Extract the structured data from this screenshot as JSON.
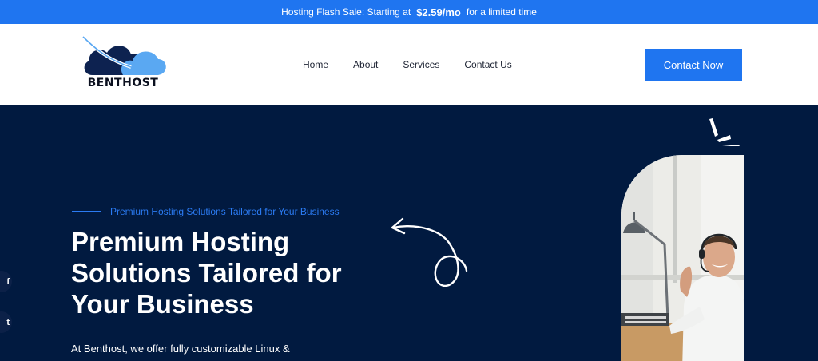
{
  "topbar": {
    "text_before": "Hosting Flash Sale: Starting at",
    "price": "$2.59/mo",
    "text_after": "for a limited time"
  },
  "header": {
    "logo_text": "BENTHOST",
    "nav": [
      {
        "label": "Home"
      },
      {
        "label": "About"
      },
      {
        "label": "Services"
      },
      {
        "label": "Contact Us"
      }
    ],
    "cta_label": "Contact Now"
  },
  "hero": {
    "tagline": "Premium Hosting Solutions Tailored for Your Business",
    "title": "Premium Hosting Solutions Tailored for Your Business",
    "desc_start": "At Benthost, we offer",
    "desc_bold": "fully customizable Linux &"
  },
  "social": [
    {
      "icon": "facebook-icon",
      "glyph": "f"
    },
    {
      "icon": "twitter-icon",
      "glyph": "t"
    }
  ],
  "colors": {
    "accent": "#1f75f0",
    "hero_background": "#011a40",
    "tagline": "#2b7bf3"
  }
}
